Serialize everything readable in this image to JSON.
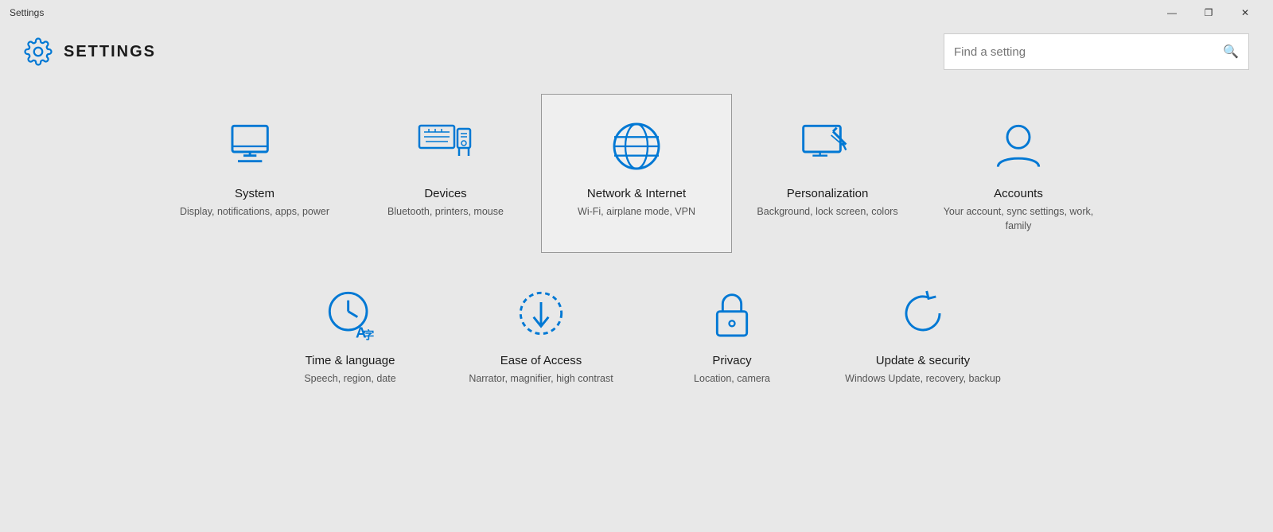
{
  "titleBar": {
    "title": "Settings",
    "minimizeLabel": "—",
    "maximizeLabel": "❐",
    "closeLabel": "✕"
  },
  "header": {
    "appTitle": "SETTINGS",
    "search": {
      "placeholder": "Find a setting"
    }
  },
  "settings": {
    "row1": [
      {
        "id": "system",
        "name": "System",
        "desc": "Display, notifications, apps, power",
        "highlighted": false
      },
      {
        "id": "devices",
        "name": "Devices",
        "desc": "Bluetooth, printers, mouse",
        "highlighted": false
      },
      {
        "id": "network",
        "name": "Network & Internet",
        "desc": "Wi-Fi, airplane mode, VPN",
        "highlighted": true
      },
      {
        "id": "personalization",
        "name": "Personalization",
        "desc": "Background, lock screen, colors",
        "highlighted": false
      },
      {
        "id": "accounts",
        "name": "Accounts",
        "desc": "Your account, sync settings, work, family",
        "highlighted": false
      }
    ],
    "row2": [
      {
        "id": "time",
        "name": "Time & language",
        "desc": "Speech, region, date",
        "highlighted": false
      },
      {
        "id": "ease",
        "name": "Ease of Access",
        "desc": "Narrator, magnifier, high contrast",
        "highlighted": false
      },
      {
        "id": "privacy",
        "name": "Privacy",
        "desc": "Location, camera",
        "highlighted": false
      },
      {
        "id": "update",
        "name": "Update & security",
        "desc": "Windows Update, recovery, backup",
        "highlighted": false
      }
    ]
  }
}
